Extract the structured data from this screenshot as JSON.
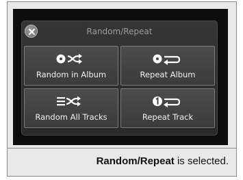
{
  "menu": {
    "title": "Random/Repeat",
    "close_icon": "close-icon",
    "options": [
      {
        "label": "Random in Album",
        "icon": "disc-shuffle-icon"
      },
      {
        "label": "Repeat Album",
        "icon": "disc-repeat-icon"
      },
      {
        "label": "Random All Tracks",
        "icon": "list-shuffle-icon"
      },
      {
        "label": "Repeat Track",
        "icon": "one-repeat-icon"
      }
    ]
  },
  "caption": {
    "bold": "Random/Repeat",
    "rest": " is selected."
  },
  "colors": {
    "panel": "#2f2f2f",
    "button": "#444444",
    "text": "#f2f2f2",
    "title": "#9c9c9c"
  }
}
